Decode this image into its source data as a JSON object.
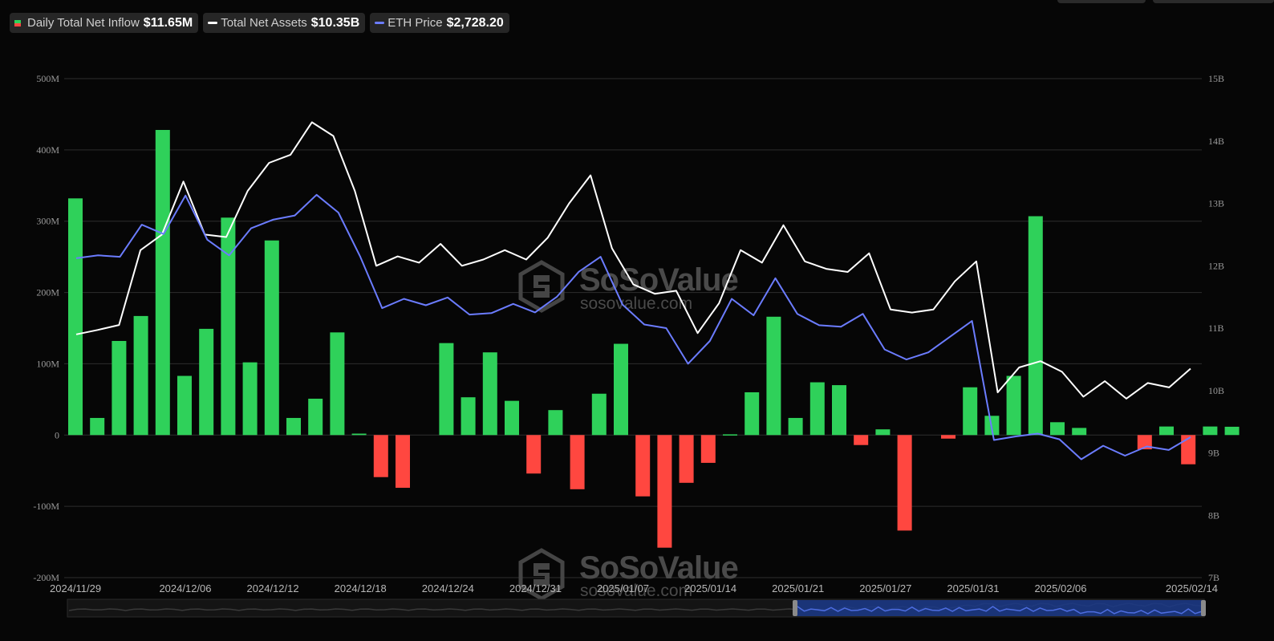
{
  "legend": [
    {
      "name": "Daily Total Net Inflow",
      "value": "$11.65M",
      "icon": "split-square-icon",
      "colors": [
        "#2fd15a",
        "#ff4740"
      ]
    },
    {
      "name": "Total Net Assets",
      "value": "$10.35B",
      "icon": "line-icon",
      "color": "#ffffff"
    },
    {
      "name": "ETH Price",
      "value": "$2,728.20",
      "icon": "line-icon",
      "color": "#6b7cff"
    }
  ],
  "watermark": {
    "title": "SoSoValue",
    "subtitle": "sosovalue.com"
  },
  "colors": {
    "positive": "#2fd15a",
    "negative": "#ff4740",
    "assets": "#ffffff",
    "price": "#6b7cff",
    "grid": "#2e2e2e",
    "navigator_fill": "#1b3a8a"
  },
  "chart_data": {
    "type": "bar",
    "x_tick_labels": [
      "2024/11/29",
      "2024/12/06",
      "2024/12/12",
      "2024/12/18",
      "2024/12/24",
      "2024/12/31",
      "2025/01/07",
      "2025/01/14",
      "2025/01/21",
      "2025/01/27",
      "2025/01/31",
      "2025/02/06",
      "2025/02/14"
    ],
    "y_left_ticks": [
      "500M",
      "400M",
      "300M",
      "200M",
      "100M",
      "0",
      "-100M",
      "-200M"
    ],
    "y_right_ticks": [
      "15B",
      "14B",
      "13B",
      "12B",
      "11B",
      "10B",
      "9B",
      "8B",
      "7B"
    ],
    "ylim_left": [
      -200,
      500
    ],
    "ylim_right": [
      7,
      15
    ],
    "grid": true,
    "legend_position": "top-left",
    "series": [
      {
        "name": "Daily Total Net Inflow",
        "type": "bar",
        "unit": "M USD",
        "values": [
          332,
          24,
          132,
          167,
          428,
          83,
          149,
          305,
          102,
          273,
          24,
          51,
          144,
          2,
          -59,
          -74,
          0,
          129,
          53,
          116,
          48,
          -54,
          35,
          -76,
          58,
          128,
          -86,
          -158,
          -67,
          -39,
          1,
          60,
          166,
          24,
          74,
          70,
          -14,
          8,
          -134,
          0,
          -5,
          67,
          27,
          83,
          307,
          18,
          10,
          0,
          0,
          -20,
          12,
          -41,
          12,
          11.65
        ]
      },
      {
        "name": "Total Net Assets",
        "type": "line",
        "unit": "B USD",
        "values": [
          10.9,
          10.97,
          11.05,
          12.25,
          12.5,
          13.35,
          12.5,
          12.46,
          13.2,
          13.65,
          13.78,
          14.3,
          14.08,
          13.2,
          12.0,
          12.15,
          12.05,
          12.35,
          12.0,
          12.1,
          12.25,
          12.1,
          12.45,
          13.0,
          13.45,
          12.28,
          11.7,
          11.55,
          11.6,
          10.92,
          11.4,
          12.25,
          12.05,
          12.65,
          12.07,
          11.95,
          11.9,
          12.2,
          11.3,
          11.25,
          11.3,
          11.75,
          12.07,
          9.97,
          10.37,
          10.47,
          10.3,
          9.9,
          10.15,
          9.87,
          10.12,
          10.05,
          10.35
        ]
      },
      {
        "name": "ETH Price",
        "type": "line",
        "unit": "USD",
        "values": [
          3580,
          3620,
          3600,
          4050,
          3920,
          4460,
          3840,
          3620,
          4000,
          4120,
          4180,
          4470,
          4220,
          3600,
          2880,
          3010,
          2920,
          3030,
          2790,
          2810,
          2940,
          2820,
          3040,
          3390,
          3600,
          2930,
          2650,
          2600,
          2100,
          2420,
          3010,
          2780,
          3300,
          2800,
          2640,
          2620,
          2800,
          2300,
          2160,
          2260,
          2480,
          2700,
          1030,
          1080,
          1120,
          1040,
          760,
          950,
          810,
          940,
          890,
          1070
        ]
      }
    ]
  }
}
